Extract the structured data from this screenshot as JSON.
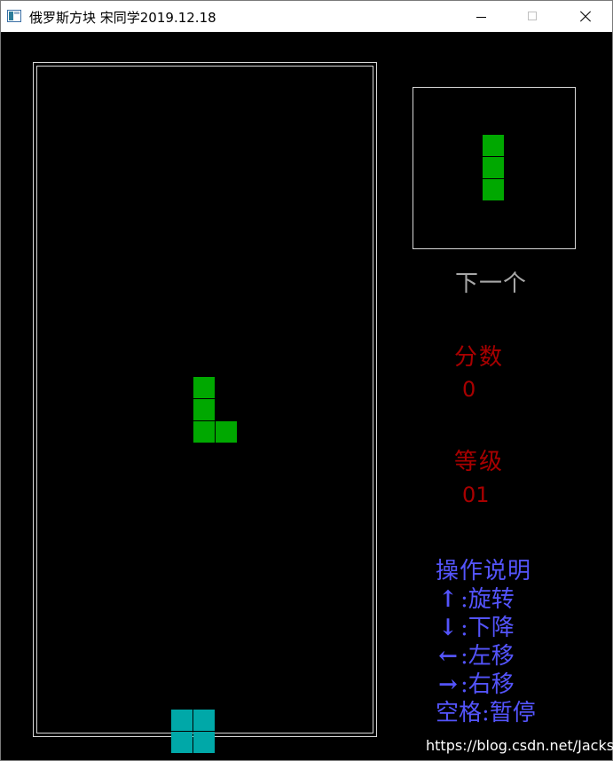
{
  "window": {
    "title": "俄罗斯方块  宋同学2019.12.18",
    "icon": "app-window-icon"
  },
  "colors": {
    "background": "#000000",
    "border": "#d8d8d8",
    "current_piece": "#00a800",
    "landed_piece": "#00a8a8",
    "next_piece": "#00a800",
    "next_label": "#a8a8a8",
    "stats": "#a80000",
    "help": "#5454fc"
  },
  "board": {
    "current_piece": {
      "shape": "L",
      "cells": [
        [
          7,
          14
        ],
        [
          7,
          15
        ],
        [
          7,
          16
        ],
        [
          8,
          16
        ]
      ]
    },
    "landed_cells": [
      [
        6,
        29
      ],
      [
        7,
        29
      ],
      [
        6,
        30
      ],
      [
        7,
        30
      ]
    ]
  },
  "next": {
    "label": "下一个",
    "shape": "I3",
    "cells": [
      [
        0,
        0
      ],
      [
        0,
        1
      ],
      [
        0,
        2
      ]
    ]
  },
  "score": {
    "label": "分数",
    "value": "0"
  },
  "level": {
    "label": "等级",
    "value": "01"
  },
  "help": {
    "title": "操作说明",
    "items": [
      {
        "key": "↑",
        "key_icon": "arrow-up-icon",
        "sep": ":",
        "action": "旋转"
      },
      {
        "key": "↓",
        "key_icon": "arrow-down-icon",
        "sep": ":",
        "action": "下降"
      },
      {
        "key": "←",
        "key_icon": "arrow-left-icon",
        "sep": ":",
        "action": "左移"
      },
      {
        "key": "→",
        "key_icon": "arrow-right-icon",
        "sep": ":",
        "action": "右移"
      },
      {
        "key": "空格",
        "key_icon": "",
        "sep": ":",
        "action": "暂停"
      }
    ]
  },
  "watermark": "https://blog.csdn.net/Jacksqh"
}
